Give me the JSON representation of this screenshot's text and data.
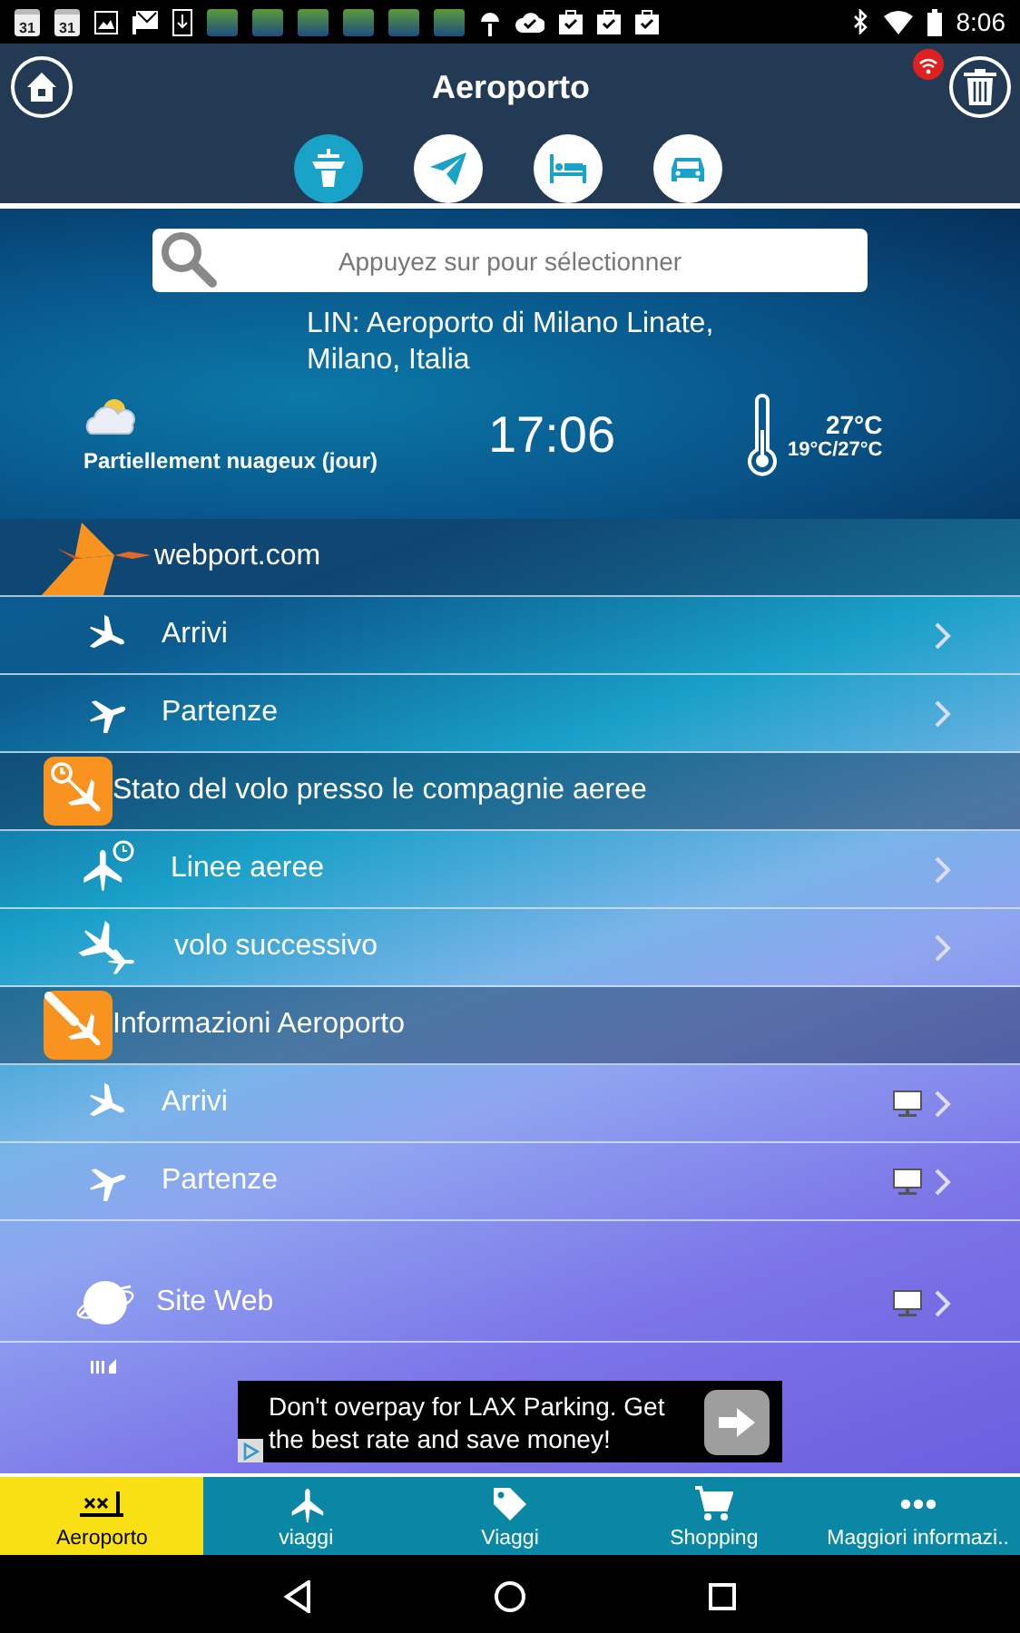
{
  "status_bar": {
    "calendar_days": [
      "31",
      "31"
    ],
    "time": "8:06"
  },
  "header": {
    "title": "Aeroporto",
    "tabs": [
      {
        "kind": "tower",
        "selected": true
      },
      {
        "kind": "flight",
        "selected": false
      },
      {
        "kind": "hotel",
        "selected": false
      },
      {
        "kind": "car",
        "selected": false
      }
    ]
  },
  "search": {
    "placeholder": "Appuyez sur pour sélectionner"
  },
  "location": "LIN: Aeroporto di Milano Linate, Milano, Italia",
  "weather": {
    "condition": "Partiellement nuageux (jour)",
    "time": "17:06",
    "temperature": "27°C",
    "range": "19°C/27°C"
  },
  "rows": [
    {
      "kind": "brand",
      "label": "webport.com"
    },
    {
      "kind": "arrivals",
      "label": "Arrivi",
      "monitor": false
    },
    {
      "kind": "departures",
      "label": "Partenze",
      "monitor": false
    },
    {
      "kind": "status",
      "label": "Stato del volo presso le compagnie aeree"
    },
    {
      "kind": "airlines",
      "label": "Linee aeree",
      "monitor": false
    },
    {
      "kind": "connection",
      "label": "volo successivo",
      "monitor": false
    },
    {
      "kind": "info",
      "label": "Informazioni Aeroporto"
    },
    {
      "kind": "arrivals",
      "label": "Arrivi",
      "monitor": true
    },
    {
      "kind": "departures",
      "label": "Partenze",
      "monitor": true
    },
    {
      "kind": "website",
      "label": "Site Web",
      "monitor": true
    }
  ],
  "ad": {
    "text": "Don't overpay for LAX Parking. Get the best rate and save money!"
  },
  "bottom_nav": [
    {
      "kind": "airport",
      "label": "Aeroporto",
      "selected": true
    },
    {
      "kind": "plane",
      "label": "viaggi",
      "selected": false
    },
    {
      "kind": "tag",
      "label": "Viaggi",
      "selected": false
    },
    {
      "kind": "cart",
      "label": "Shopping",
      "selected": false
    },
    {
      "kind": "more",
      "label": "Maggiori informazi..",
      "selected": false
    }
  ]
}
